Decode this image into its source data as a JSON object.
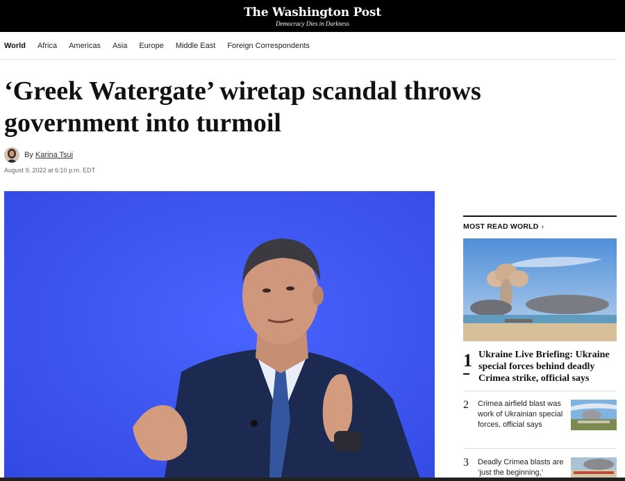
{
  "masthead": {
    "logo": "The Washington Post",
    "tagline": "Democracy Dies in Darkness"
  },
  "nav": {
    "items": [
      "World",
      "Africa",
      "Americas",
      "Asia",
      "Europe",
      "Middle East",
      "Foreign Correspondents"
    ]
  },
  "article": {
    "headline": "‘Greek Watergate’ wiretap scandal throws government into turmoil",
    "byline_prefix": "By",
    "author": "Karina Tsui",
    "date": "August 9, 2022 at 6:10 p.m. EDT"
  },
  "most_read": {
    "title": "MOST READ WORLD",
    "chevron": "›",
    "items": [
      {
        "num": "1",
        "title": "Ukraine Live Briefing: Ukraine special forces behind deadly Crimea strike, official says"
      },
      {
        "num": "2",
        "title": "Crimea airfield blast was work of Ukrainian special forces, official says"
      },
      {
        "num": "3",
        "title": "Deadly Crimea blasts are ‘just the beginning,’"
      }
    ]
  },
  "colors": {
    "masthead_bg": "#000000",
    "hero_bg": "#3f58ef"
  }
}
